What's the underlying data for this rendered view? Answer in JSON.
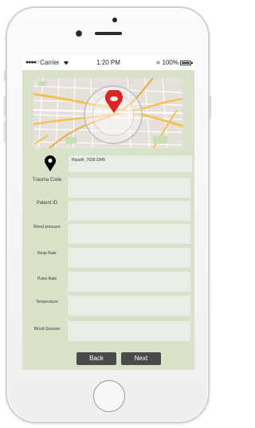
{
  "status_bar": {
    "signal_dots": "●●●●○",
    "carrier": "Carrier",
    "time": "1:20 PM",
    "battery": "100%"
  },
  "location": {
    "icon": "map-pin-icon",
    "text": "Riyadh ,7036:3345"
  },
  "form": {
    "fields": [
      {
        "label": "Trauma Code",
        "value": ""
      },
      {
        "label": "Patient ID",
        "value": ""
      },
      {
        "label": "Blood pressure",
        "value": ""
      },
      {
        "label": "Resp Rate",
        "value": ""
      },
      {
        "label": "Pulse Rate",
        "value": ""
      },
      {
        "label": "Temperature",
        "value": ""
      },
      {
        "label": "Blood Glucose",
        "value": ""
      }
    ]
  },
  "buttons": {
    "back": "Back",
    "next": "Next"
  },
  "colors": {
    "screen_bg": "#d8e2c8",
    "field_bg": "#e6eee5",
    "button_bg": "#4a4a4a",
    "map_pin": "#e02424"
  }
}
